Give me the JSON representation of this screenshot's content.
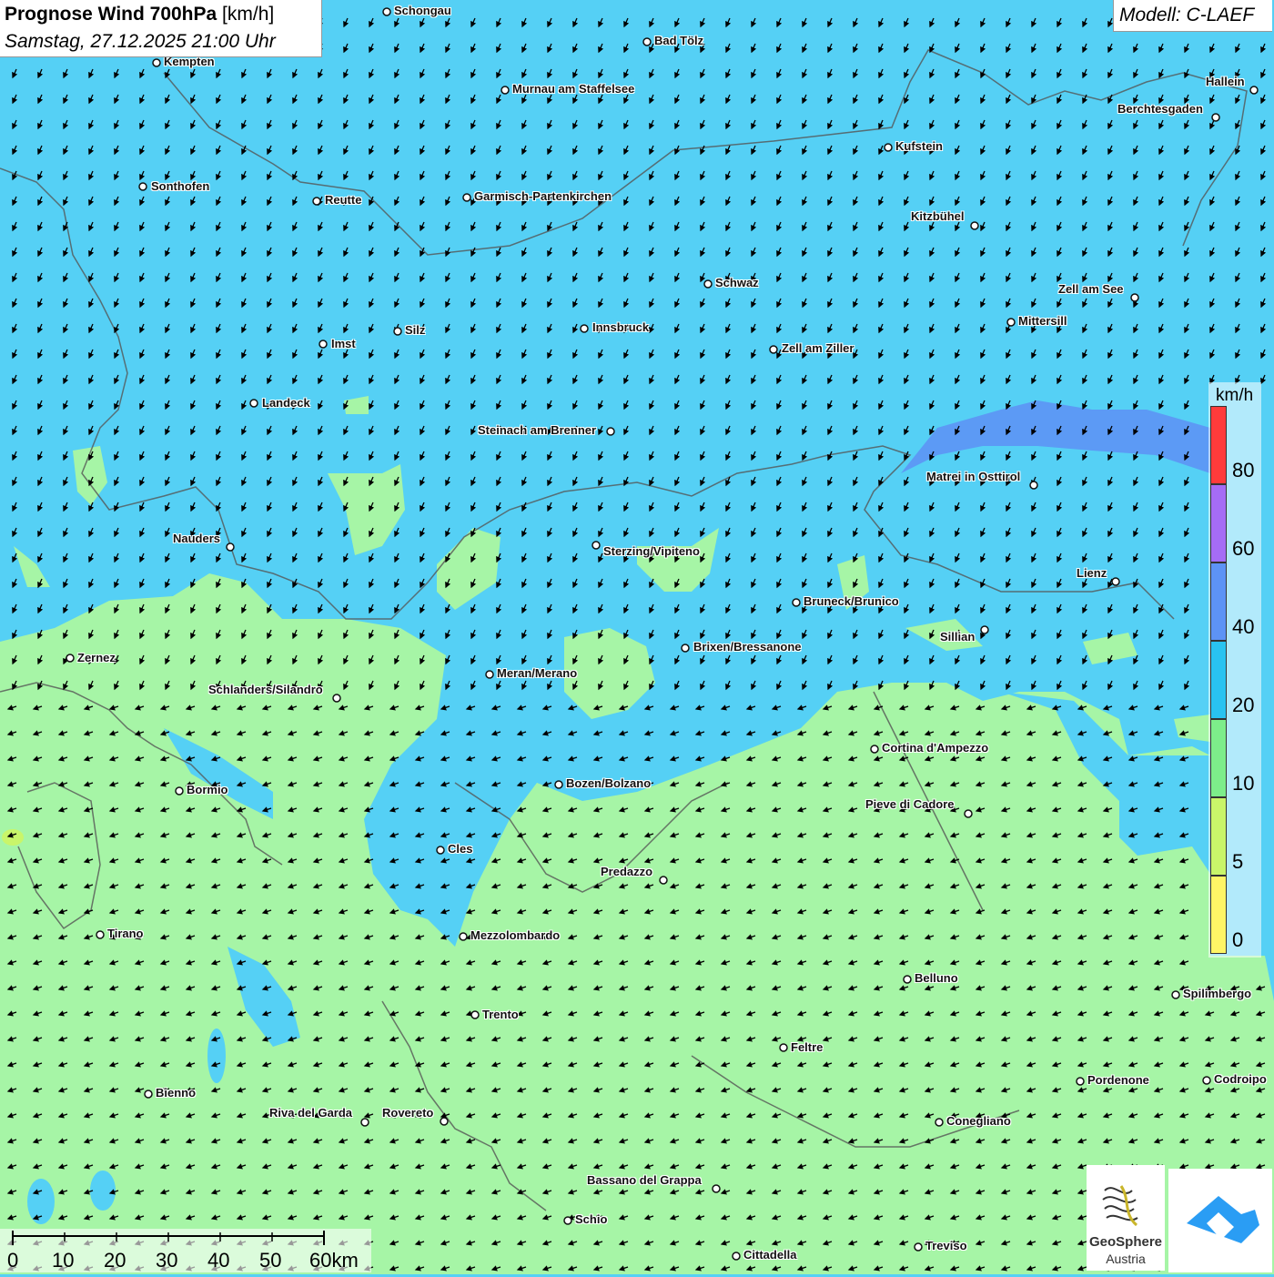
{
  "header": {
    "title_bold": "Prognose Wind 700hPa",
    "title_unit": "[km/h]",
    "datetime": "Samstag, 27.12.2025 21:00 Uhr",
    "model": "Modell: C-LAEF"
  },
  "legend": {
    "unit": "km/h",
    "ticks": [
      "80",
      "60",
      "40",
      "20",
      "10",
      "5",
      "0"
    ],
    "colors": [
      "#ff3b3b",
      "#a56cf5",
      "#5d93f5",
      "#29c3f0",
      "#7ded8a",
      "#c9f56a",
      "#fff566"
    ]
  },
  "scale": {
    "labels": [
      "0",
      "10",
      "20",
      "30",
      "40",
      "50",
      "60km"
    ]
  },
  "logo": {
    "name_line1": "GeoSphere",
    "name_line2": "Austria"
  },
  "colors": {
    "wind_blue": "#55d0f5",
    "wind_green": "#a6f5a6",
    "wind_purple": "#5d93f5"
  },
  "cities": [
    {
      "name": "Schongau"
    },
    {
      "name": "Bad Tölz"
    },
    {
      "name": "Kempten"
    },
    {
      "name": "Hallein"
    },
    {
      "name": "Murnau am Staffelsee"
    },
    {
      "name": "Berchtesgaden"
    },
    {
      "name": "Kufstein"
    },
    {
      "name": "Sonthofen"
    },
    {
      "name": "Reutte"
    },
    {
      "name": "Garmisch-Partenkirchen"
    },
    {
      "name": "Kitzbühel"
    },
    {
      "name": "Schwaz"
    },
    {
      "name": "Zell am See"
    },
    {
      "name": "Innsbruck"
    },
    {
      "name": "Mittersill"
    },
    {
      "name": "Silz"
    },
    {
      "name": "Imst"
    },
    {
      "name": "Zell am Ziller"
    },
    {
      "name": "Landeck"
    },
    {
      "name": "Steinach am Brenner"
    },
    {
      "name": "Matrei in Osttirol"
    },
    {
      "name": "Nauders"
    },
    {
      "name": "Sterzing/Vipiteno"
    },
    {
      "name": "Lienz"
    },
    {
      "name": "Bruneck/Brunico"
    },
    {
      "name": "Sillian"
    },
    {
      "name": "Zernez"
    },
    {
      "name": "Brixen/Bressanone"
    },
    {
      "name": "Meran/Merano"
    },
    {
      "name": "Schlanders/Silandro"
    },
    {
      "name": "Cortina d'Ampezzo"
    },
    {
      "name": "Bozen/Bolzano"
    },
    {
      "name": "Bormio"
    },
    {
      "name": "Pieve di Cadore"
    },
    {
      "name": "Cles"
    },
    {
      "name": "Predazzo"
    },
    {
      "name": "Tirano"
    },
    {
      "name": "Mezzolombardo"
    },
    {
      "name": "Belluno"
    },
    {
      "name": "Spilimbergo"
    },
    {
      "name": "Trento"
    },
    {
      "name": "Feltre"
    },
    {
      "name": "Pordenone"
    },
    {
      "name": "Codroipo"
    },
    {
      "name": "Bienno"
    },
    {
      "name": "Riva del Garda"
    },
    {
      "name": "Rovereto"
    },
    {
      "name": "Conegliano"
    },
    {
      "name": "Bassano del Grappa"
    },
    {
      "name": "Schio"
    },
    {
      "name": "Treviso"
    },
    {
      "name": "Cittadella"
    }
  ]
}
